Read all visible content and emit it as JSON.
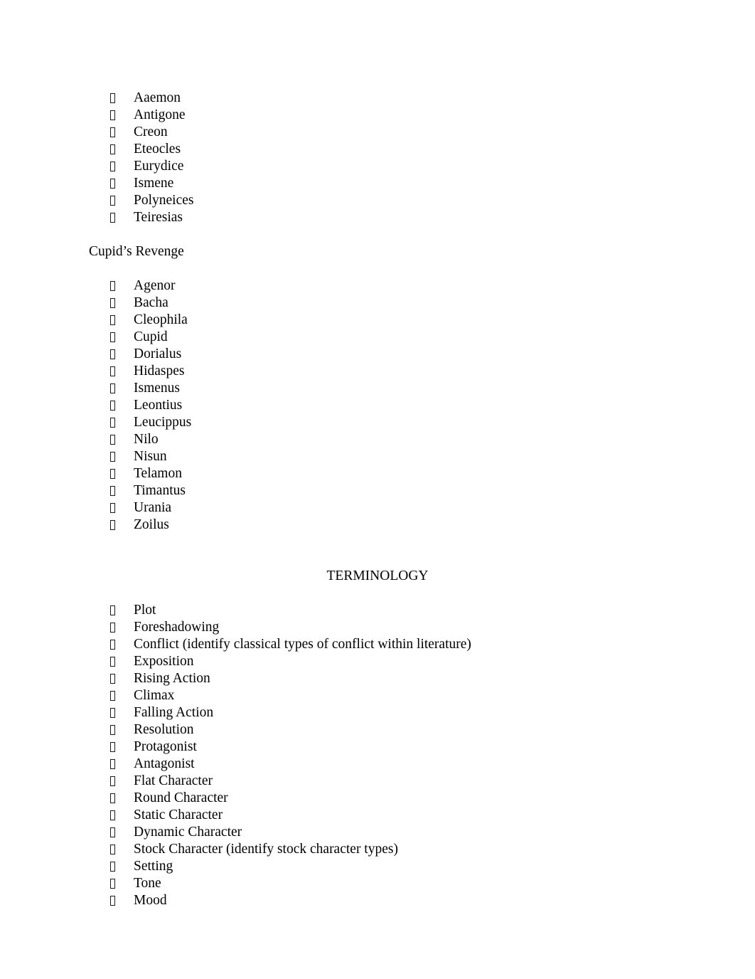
{
  "document": {
    "background_color": "#ffffff",
    "text_color": "#000000",
    "bullet_glyph": "missing-glyph-box",
    "antigone_characters": [
      "Aaemon",
      "Antigone",
      "Creon",
      "Eteocles",
      "Eurydice",
      "Ismene",
      "Polyneices",
      "Teiresias"
    ],
    "cupids_revenge_heading": "Cupid’s Revenge",
    "cupids_revenge_characters": [
      "Agenor",
      "Bacha",
      "Cleophila",
      "Cupid",
      "Dorialus",
      "Hidaspes",
      "Ismenus",
      "Leontius",
      "Leucippus",
      "Nilo",
      "Nisun",
      "Telamon",
      "Timantus",
      "Urania",
      "Zoilus"
    ],
    "terminology_heading": "TERMINOLOGY",
    "terminology_items": [
      "Plot",
      "Foreshadowing",
      "Conflict (identify classical types of conflict within literature)",
      "Exposition",
      "Rising Action",
      "Climax",
      "Falling Action",
      "Resolution",
      "Protagonist",
      "Antagonist",
      "Flat Character",
      "Round Character",
      "Static Character",
      "Dynamic Character",
      "Stock Character (identify stock character types)",
      "Setting",
      "Tone",
      "Mood"
    ]
  }
}
